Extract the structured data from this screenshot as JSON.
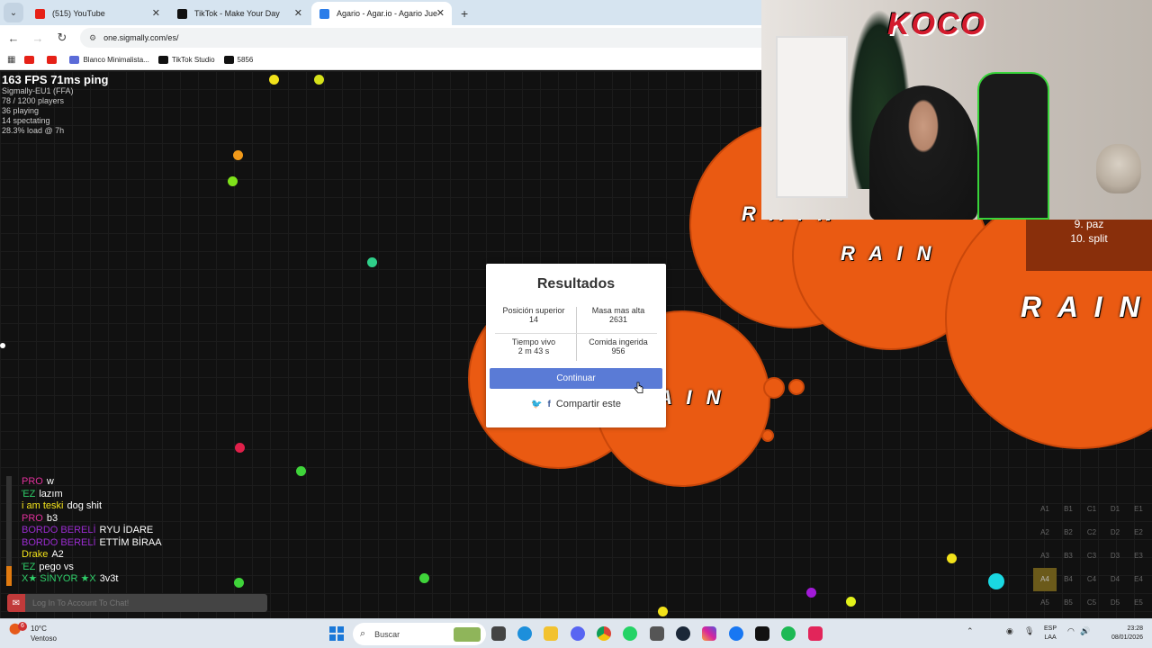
{
  "browser": {
    "tabs": [
      {
        "label": "(515) YouTube",
        "color": "#e62117"
      },
      {
        "label": "TikTok - Make Your Day",
        "color": "#111111"
      },
      {
        "label": "Agario - Agar.io - Agario Juego",
        "color": "#2b7de9"
      }
    ],
    "tab_menu_icon": "chevron-down-icon",
    "url": "one.sigmally.com/es/",
    "bookmarks": [
      {
        "label": "",
        "color": "#e62117"
      },
      {
        "label": "",
        "color": "#e62117"
      },
      {
        "label": "Blanco Minimalista...",
        "color": "#5b6bd8"
      },
      {
        "label": "TikTok Studio",
        "color": "#111111"
      },
      {
        "label": "5856",
        "color": "#111111"
      }
    ]
  },
  "game": {
    "fps_line": "163 FPS 71ms ping",
    "stats": [
      "Sigmally-EU1 (FFA)",
      "78 / 1200 players",
      "36 playing",
      "14 spectating",
      "28.3% load @ 7h"
    ],
    "cell_name": "R A I N",
    "leaderboard": [
      "9. paz",
      "10. split"
    ],
    "colors": {
      "cell": "#ea5a12",
      "pellet_green": "#3fd43a",
      "pellet_yellow": "#f2e21a"
    }
  },
  "results": {
    "title": "Resultados",
    "top_position_label": "Posición superior",
    "top_position_value": "14",
    "max_mass_label": "Masa mas alta",
    "max_mass_value": "2631",
    "time_alive_label": "Tiempo vivo",
    "time_alive_value": "2 m 43 s",
    "food_eaten_label": "Comida ingerida",
    "food_eaten_value": "956",
    "continue_label": "Continuar",
    "share_label": "Compartir este"
  },
  "chat": {
    "messages": [
      {
        "name": "PRO",
        "text": "w",
        "color": "#e0309a"
      },
      {
        "name": "ΈZ",
        "text": "lazım",
        "color": "#2fd06a"
      },
      {
        "name": "i am teski",
        "text": "dog shit",
        "color": "#f2e21a"
      },
      {
        "name": "PRO",
        "text": "b3",
        "color": "#e0309a"
      },
      {
        "name": "BORDO BERELİ",
        "text": "RYU İDARE",
        "color": "#9a2bd0"
      },
      {
        "name": "BORDO BERELİ",
        "text": "ETTİM BİRAA",
        "color": "#9a2bd0"
      },
      {
        "name": "Drake",
        "text": "A2",
        "color": "#f2e21a"
      },
      {
        "name": "ΈZ",
        "text": "pego vs",
        "color": "#2fd06a"
      },
      {
        "name": "X★ SİNYOR ★X",
        "text": "3v3t",
        "color": "#2fd06a"
      }
    ],
    "input_placeholder": "Log In To Account To Chat!"
  },
  "minimap": {
    "cells": [
      "A1",
      "B1",
      "C1",
      "D1",
      "E1",
      "A2",
      "B2",
      "C2",
      "D2",
      "E2",
      "A3",
      "B3",
      "C3",
      "D3",
      "E3",
      "A4",
      "B4",
      "C4",
      "D4",
      "E4",
      "A5",
      "B5",
      "C5",
      "D5",
      "E5"
    ],
    "highlight": "A4"
  },
  "webcam": {
    "graffiti": "KOCO"
  },
  "taskbar": {
    "temperature": "10°C",
    "weather": "Ventoso",
    "weather_badge": "6",
    "search_placeholder": "Buscar",
    "language": "ESP",
    "region": "LAA",
    "time": "23:28",
    "date": "08/01/2026"
  }
}
